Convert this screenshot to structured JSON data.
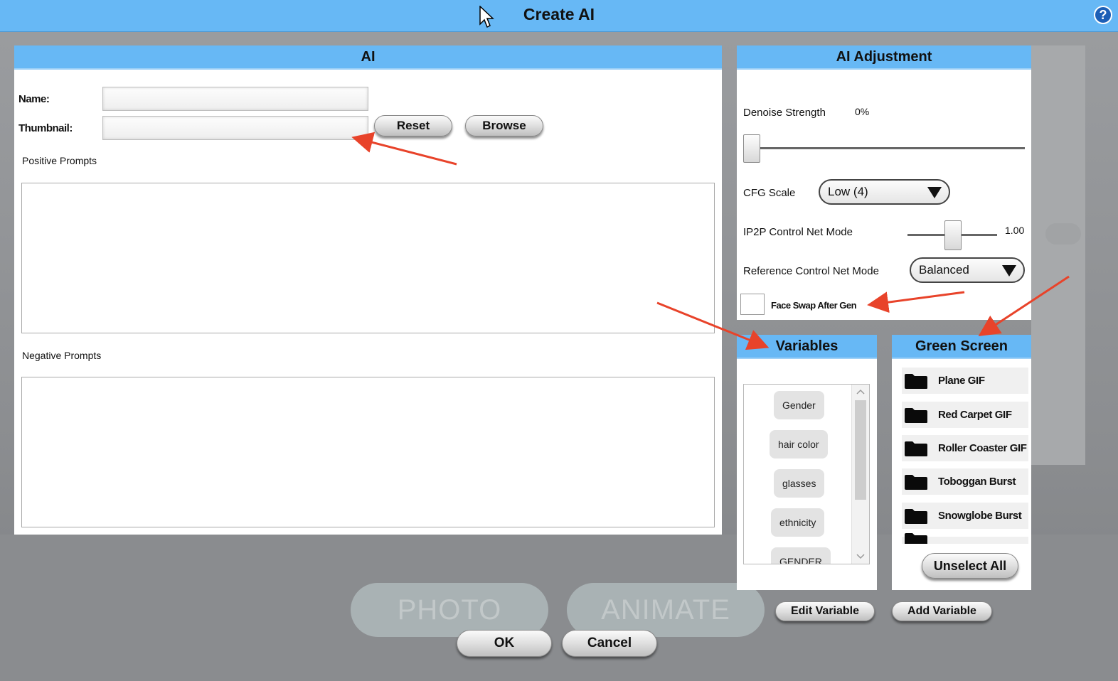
{
  "window": {
    "title": "Create AI",
    "help_label": "?"
  },
  "ai_panel": {
    "header": "AI",
    "name_label": "Name:",
    "name_value": "",
    "thumbnail_label": "Thumbnail:",
    "thumbnail_value": "",
    "reset_label": "Reset",
    "browse_label": "Browse",
    "positive_label": "Positive Prompts",
    "positive_value": "",
    "negative_label": "Negative Prompts",
    "negative_value": ""
  },
  "adjustment": {
    "header": "AI Adjustment",
    "denoise_label": "Denoise Strength",
    "denoise_value": "0%",
    "denoise_level": 0,
    "cfg_label": "CFG Scale",
    "cfg_value": "Low (4)",
    "ip2p_label": "IP2P Control Net Mode",
    "ip2p_value": "1.00",
    "reference_label": "Reference Control Net Mode",
    "reference_value": "Balanced",
    "face_swap_label": "Face Swap After Gen",
    "face_swap_checked": false
  },
  "variables": {
    "header": "Variables",
    "items": [
      "Gender",
      "hair color",
      "glasses",
      "ethnicity",
      "GENDER"
    ],
    "edit_label": "Edit Variable",
    "add_label": "Add Variable"
  },
  "green_screen": {
    "header": "Green Screen",
    "items": [
      "Plane GIF",
      "Red Carpet GIF",
      "Roller Coaster GIF",
      "Toboggan Burst",
      "Snowglobe Burst"
    ],
    "unselect_label": "Unselect All"
  },
  "background": {
    "photo_label": "PHOTO",
    "animate_label": "ANIMATE"
  },
  "footer": {
    "ok_label": "OK",
    "cancel_label": "Cancel"
  },
  "colors": {
    "header_blue": "#67b8f5",
    "annotation_red": "#e8432a"
  }
}
